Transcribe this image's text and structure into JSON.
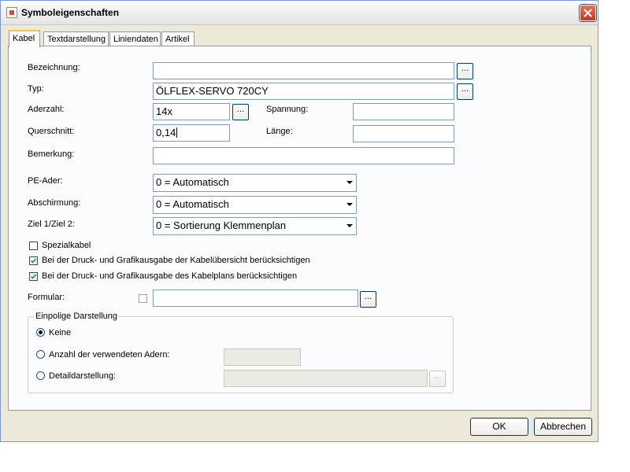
{
  "window": {
    "title": "Symboleigenschaften"
  },
  "tabs": [
    {
      "label": "Kabel",
      "active": true
    },
    {
      "label": "Textdarstellung",
      "active": false
    },
    {
      "label": "Liniendaten",
      "active": false
    },
    {
      "label": "Artikel",
      "active": false
    }
  ],
  "fields": {
    "bezeichnung": {
      "label": "Bezeichnung:",
      "value": ""
    },
    "typ": {
      "label": "Typ:",
      "value": "ÖLFLEX-SERVO 720CY"
    },
    "aderzahl": {
      "label": "Aderzahl:",
      "value": "14x"
    },
    "spannung": {
      "label": "Spannung:",
      "value": ""
    },
    "querschnitt": {
      "label": "Querschnitt:",
      "value": "0,14"
    },
    "laenge": {
      "label": "Länge:",
      "value": ""
    },
    "bemerkung": {
      "label": "Bemerkung:",
      "value": ""
    },
    "pe_ader": {
      "label": "PE-Ader:",
      "value": "0 = Automatisch"
    },
    "abschirmung": {
      "label": "Abschirmung:",
      "value": "0 = Automatisch"
    },
    "ziel": {
      "label": "Ziel 1/Ziel 2:",
      "value": "0 = Sortierung Klemmenplan"
    },
    "formular": {
      "label": "Formular:",
      "value": ""
    }
  },
  "browse_label": "...",
  "checkboxes": [
    {
      "label": "Spezialkabel",
      "checked": false
    },
    {
      "label": "Bei der Druck- und Grafikausgabe der Kabelübersicht berücksichtigen",
      "checked": true
    },
    {
      "label": "Bei der Druck- und Grafikausgabe des Kabelplans berücksichtigen",
      "checked": true
    }
  ],
  "einpolige": {
    "title": "Einpolige Darstellung",
    "options": [
      {
        "label": "Keine",
        "selected": true
      },
      {
        "label": "Anzahl der verwendeten Adern:",
        "selected": false
      },
      {
        "label": "Detaildarstellung:",
        "selected": false
      }
    ]
  },
  "buttons": {
    "ok": "OK",
    "cancel": "Abbrechen"
  },
  "colors": {
    "dialog_bg": "#ece9d8",
    "panel_bg": "#fcfcfe",
    "field_border": "#7f9db9",
    "tab_highlight": "#f7c44f",
    "close_red": "#c53a23"
  },
  "icons": {
    "app": "app-icon",
    "close": "close-icon",
    "check": "check-icon",
    "dropdown": "chevron-down-icon"
  }
}
